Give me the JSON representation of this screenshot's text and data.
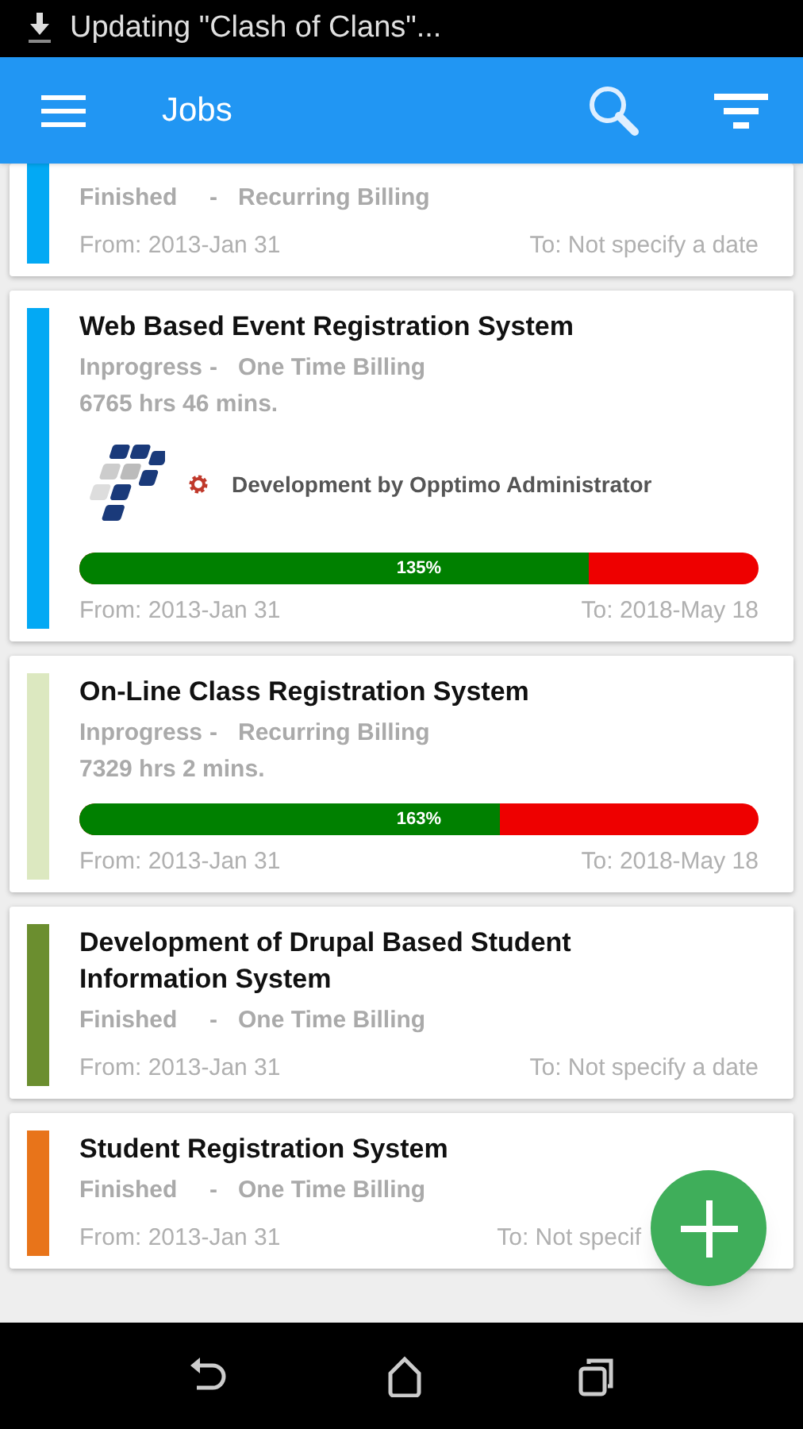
{
  "status_bar": {
    "notification": "Updating \"Clash of Clans\"..."
  },
  "toolbar": {
    "title": "Jobs"
  },
  "jobs": [
    {
      "status": "Finished",
      "separator": "-",
      "billing": "Recurring Billing",
      "from": "From: 2013-Jan 31",
      "to": "To: Not specify a date",
      "color": "#03a9f4"
    },
    {
      "title": "Web Based Event Registration System",
      "status": "Inprogress",
      "separator": "-",
      "billing": "One Time Billing",
      "hours": "6765 hrs 46 mins.",
      "assignee": "Development by Opptimo Administrator",
      "progress_label": "135%",
      "level": 0.75,
      "from": "From: 2013-Jan 31",
      "to": "To: 2018-May 18",
      "color": "#03a9f4"
    },
    {
      "title": "On-Line Class Registration System",
      "status": "Inprogress",
      "separator": "-",
      "billing": "Recurring Billing",
      "hours": "7329 hrs 2 mins.",
      "progress_label": "163%",
      "level": 0.62,
      "from": "From: 2013-Jan 31",
      "to": "To: 2018-May 18",
      "color": "#dce8c0"
    },
    {
      "title": "Development of Drupal Based Student Information System",
      "status": "Finished",
      "separator": "-",
      "billing": "One Time Billing",
      "from": "From: 2013-Jan 31",
      "to": "To: Not specify a date",
      "color": "#6b8e2f"
    },
    {
      "title": "Student Registration System",
      "status": "Finished",
      "separator": "-",
      "billing": "One Time Billing",
      "from": "From: 2013-Jan 31",
      "to": "To: Not specif",
      "color": "#e8741a"
    }
  ]
}
